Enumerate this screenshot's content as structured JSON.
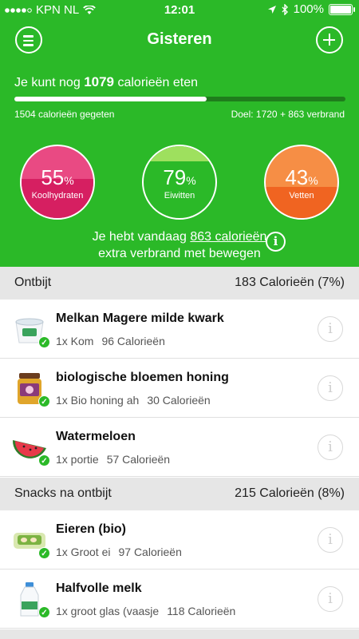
{
  "status_bar": {
    "carrier": "KPN NL",
    "time": "12:01",
    "battery": "100%"
  },
  "header": {
    "title": "Gisteren"
  },
  "calories": {
    "remaining_prefix": "Je kunt nog",
    "remaining_value": "1079",
    "remaining_suffix": "calorieën eten",
    "eaten": "1504 calorieën gegeten",
    "goal": "Doel: 1720 + 863 verbrand",
    "progress_fraction": 0.58
  },
  "macros": [
    {
      "percent": "55",
      "unit": "%",
      "label": "Koolhydraten",
      "fill_fraction": 0.55
    },
    {
      "percent": "79",
      "unit": "%",
      "label": "Eiwitten",
      "fill_fraction": 0.21
    },
    {
      "percent": "43",
      "unit": "%",
      "label": "Vetten",
      "fill_fraction": 0.43
    }
  ],
  "burn": {
    "line1_prefix": "Je hebt vandaag",
    "line1_link": "863 calorieën",
    "line2": "extra verbrand met bewegen"
  },
  "sections": [
    {
      "name": "Ontbijt",
      "calories": "183 Calorieën (7%)",
      "items": [
        {
          "name": "Melkan Magere milde kwark",
          "portion": "1x Kom",
          "calories": "96 Calorieën"
        },
        {
          "name": "biologische bloemen honing",
          "portion": "1x Bio honing ah",
          "calories": "30 Calorieën"
        },
        {
          "name": "Watermeloen",
          "portion": "1x portie",
          "calories": "57 Calorieën"
        }
      ]
    },
    {
      "name": "Snacks na ontbijt",
      "calories": "215 Calorieën (8%)",
      "items": [
        {
          "name": "Eieren (bio)",
          "portion": "1x Groot ei",
          "calories": "97 Calorieën"
        },
        {
          "name": "Halfvolle melk",
          "portion": "1x groot glas (vaasje",
          "calories": "118 Calorieën"
        }
      ]
    }
  ]
}
